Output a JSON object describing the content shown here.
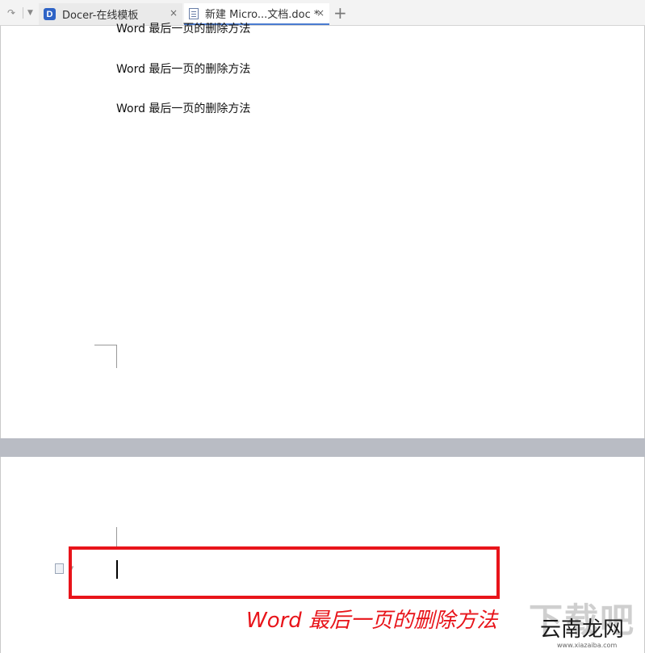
{
  "tabbar": {
    "redo_icon": "redo-arrow-icon",
    "dropdown_icon": "chevron-down-icon",
    "tabs": [
      {
        "label": "Docer-在线模板",
        "icon": "docer-logo-icon",
        "logo_letter": "D",
        "close": "×"
      },
      {
        "label": "新建 Micro...文档.doc *",
        "icon": "document-icon",
        "close": "×"
      }
    ],
    "add_tab": "+"
  },
  "document": {
    "page1_lines": [
      "Word 最后一页的删除方法",
      "Word 最后一页的删除方法",
      "Word 最后一页的删除方法"
    ]
  },
  "annotation": {
    "caption": "Word 最后一页的删除方法",
    "color": "#e8141a"
  },
  "watermark": {
    "back_text": "下载吧",
    "brand": "云南龙网",
    "url": "www.xiazaiba.com"
  }
}
